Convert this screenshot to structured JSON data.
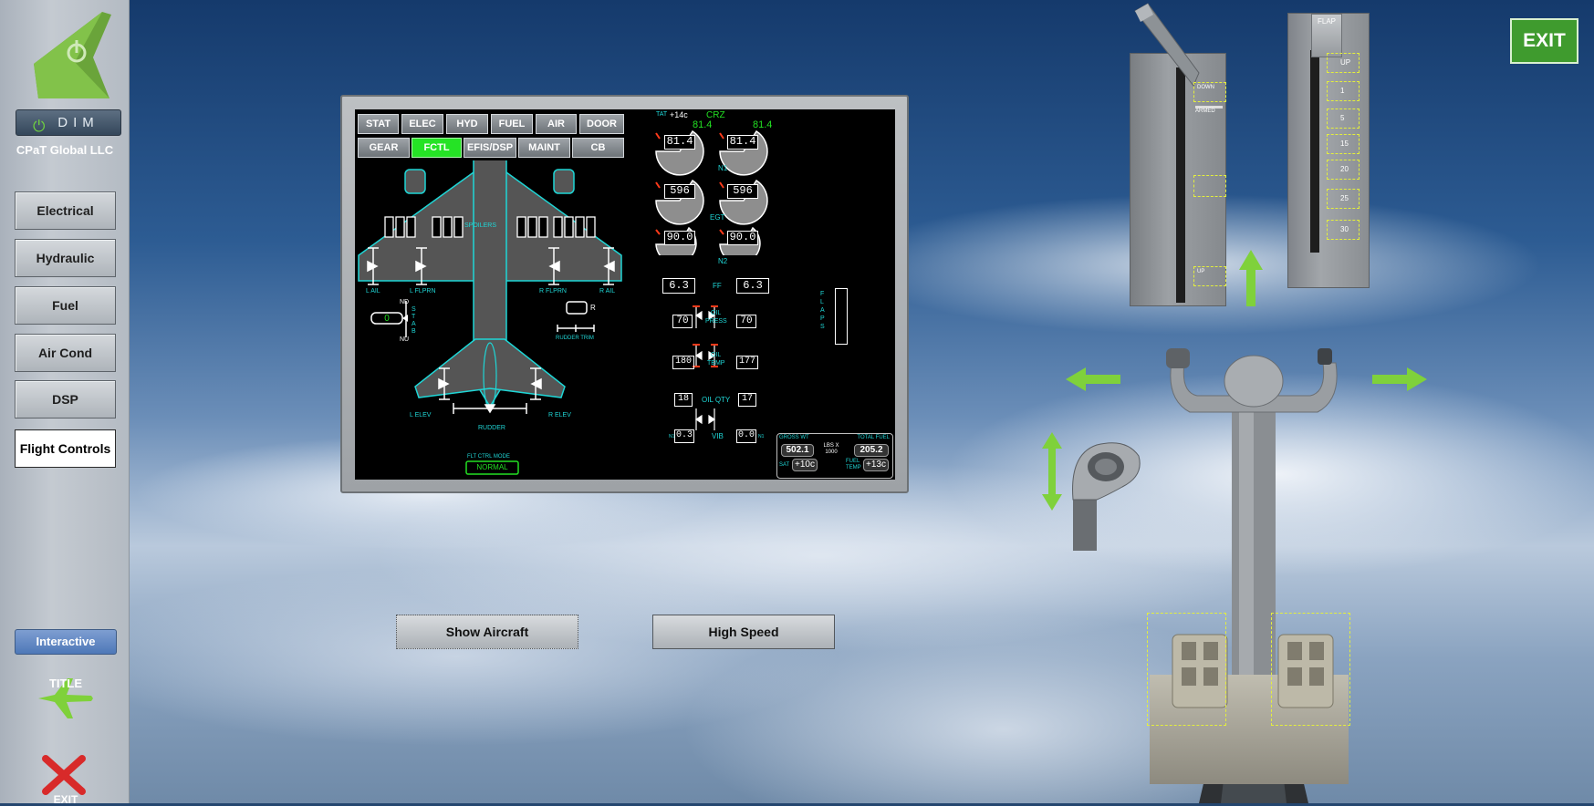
{
  "sidebar": {
    "dim_label": "DIM",
    "company": "CPaT Global LLC",
    "nav": [
      {
        "label": "Electrical"
      },
      {
        "label": "Hydraulic"
      },
      {
        "label": "Fuel"
      },
      {
        "label": "Air Cond"
      },
      {
        "label": "DSP"
      },
      {
        "label": "Flight Controls"
      }
    ],
    "interactive_label": "Interactive",
    "title_label": "TITLE",
    "exit_label": "EXIT"
  },
  "exit_button": "EXIT",
  "eicas": {
    "tabs_row1": [
      "STAT",
      "ELEC",
      "HYD",
      "FUEL",
      "AIR",
      "DOOR"
    ],
    "tabs_row2": [
      "GEAR",
      "FCTL",
      "EFIS/DSP",
      "MAINT",
      "CB"
    ],
    "active_tab": "FCTL",
    "fctl": {
      "spoilers_label": "SPOILERS",
      "l_ail": "L AIL",
      "l_flprn": "L FLPRN",
      "r_flprn": "R FLPRN",
      "r_ail": "R AIL",
      "stab_label": "STAB",
      "stab_nd": "ND",
      "stab_nu": "NU",
      "stab_value": "0",
      "rudder_trim_label": "RUDDER TRIM",
      "rudder_trim_r": "R",
      "l_elev": "L ELEV",
      "r_elev": "R ELEV",
      "rudder": "RUDDER",
      "flt_ctrl_mode_label": "FLT CTRL MODE",
      "flt_ctrl_mode_value": "NORMAL"
    },
    "engine": {
      "tat_label": "TAT",
      "tat_value": "+14c",
      "mode": "CRZ",
      "n1_target_l": "81.4",
      "n1_target_r": "81.4",
      "n1_l": "81.4",
      "n1_r": "81.4",
      "n1_label": "N1",
      "egt_l": "596",
      "egt_r": "596",
      "egt_label": "EGT",
      "n2_l": "90.0",
      "n2_r": "90.0",
      "n2_label": "N2",
      "ff_l": "6.3",
      "ff_r": "6.3",
      "ff_label": "FF",
      "oil_press_l": "70",
      "oil_press_r": "70",
      "oil_press_label_1": "OIL",
      "oil_press_label_2": "PRESS",
      "oil_temp_l": "180",
      "oil_temp_r": "177",
      "oil_temp_label_1": "OIL",
      "oil_temp_label_2": "TEMP",
      "oil_qty_l": "18",
      "oil_qty_r": "17",
      "oil_qty_label": "OIL QTY",
      "vib_l": "0.3",
      "vib_r": "0.0",
      "vib_label": "VIB",
      "vib_n1": "N1",
      "flaps_label": "FLAPS"
    },
    "weights": {
      "gross_wt_label": "GROSS WT",
      "gross_wt": "502.1",
      "units": "LBS X 1000",
      "total_fuel_label": "TOTAL FUEL",
      "total_fuel": "205.2",
      "sat_label": "SAT",
      "sat": "+10c",
      "fuel_temp_label": "FUEL TEMP",
      "fuel_temp": "+13c"
    }
  },
  "buttons": {
    "show_aircraft": "Show Aircraft",
    "high_speed": "High Speed"
  },
  "controls": {
    "speedbrake_positions": [
      "DOWN",
      "ARMED",
      "UP"
    ],
    "flap_header": "FLAP",
    "flap_detents": [
      "UP",
      "1",
      "5",
      "15",
      "20",
      "25",
      "30"
    ]
  },
  "colors": {
    "cyan": "#1fd6d6",
    "green": "#22e022",
    "accent_green": "#7fd13b"
  }
}
